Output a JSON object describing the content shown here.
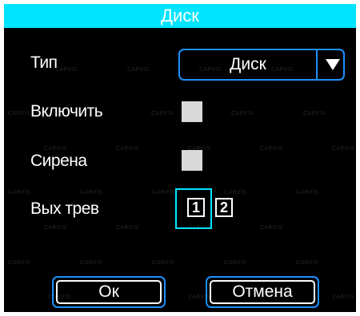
{
  "dialog": {
    "title": "Диск",
    "watermark": "CARVIS",
    "fields": {
      "type": {
        "label": "Тип",
        "value": "Диск",
        "icon": "triangle-down-icon"
      },
      "enable": {
        "label": "Включить",
        "checked": false
      },
      "siren": {
        "label": "Сирена",
        "checked": false
      },
      "alarm_out": {
        "label": "Вых трев",
        "channels": [
          "1",
          "2"
        ]
      }
    },
    "buttons": {
      "ok": "Ок",
      "cancel": "Отмена"
    }
  },
  "colors": {
    "title_bar": "#00e5ff",
    "background": "#000000",
    "focus_border": "#1e90ff",
    "checkbox": "#d9d9d9",
    "text": "#ffffff"
  }
}
